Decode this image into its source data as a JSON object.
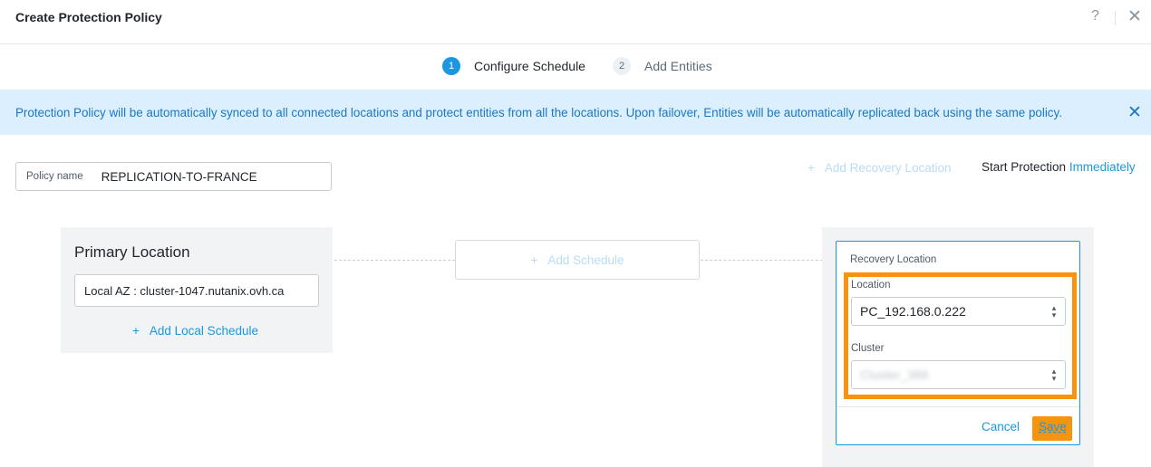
{
  "header": {
    "title": "Create Protection Policy",
    "help_label": "?",
    "close_label": "✕"
  },
  "steps": [
    {
      "number": "1",
      "label": "Configure Schedule",
      "active": true
    },
    {
      "number": "2",
      "label": "Add Entities",
      "active": false
    }
  ],
  "banner": {
    "text": "Protection Policy will be automatically synced to all connected locations and protect entities from all the locations. Upon failover, Entities will be automatically replicated back using the same policy.",
    "close_label": "✕"
  },
  "policy": {
    "label": "Policy name",
    "value": "REPLICATION-TO-FRANCE"
  },
  "actions": {
    "add_recovery_label": "Add Recovery Location",
    "start_protection_label": "Start Protection",
    "start_protection_value": "Immediately",
    "plus": "+"
  },
  "primary": {
    "title": "Primary Location",
    "selected": "Local AZ : cluster-1047.nutanix.ovh.ca",
    "add_schedule_label": "Add Local Schedule"
  },
  "schedule": {
    "add_label": "Add Schedule"
  },
  "recovery": {
    "title": "Recovery Location",
    "location_label": "Location",
    "location_value": "PC_192.168.0.222",
    "cluster_label": "Cluster",
    "cluster_value": "Cluster_388",
    "cancel_label": "Cancel",
    "save_label": "Save",
    "arrow": "⬍"
  },
  "colors": {
    "accent": "#1b97e1",
    "highlight": "#f7940c",
    "banner_bg": "#dcefff"
  }
}
